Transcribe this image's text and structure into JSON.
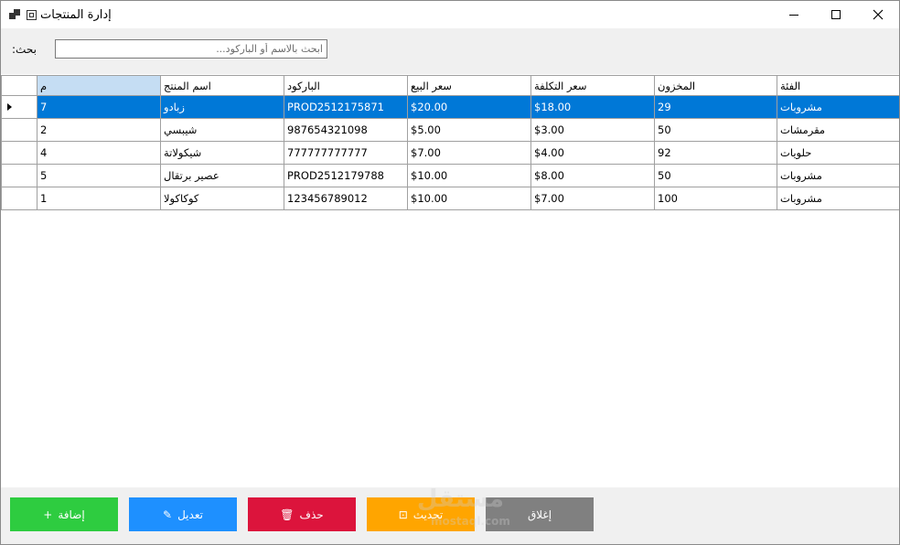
{
  "window": {
    "title": "إدارة المنتجات",
    "controls": [
      "minimize-icon",
      "maximize-icon",
      "close-icon"
    ]
  },
  "search": {
    "label": "بحث:",
    "placeholder": "ابحث بالاسم أو الباركود...",
    "value": ""
  },
  "table": {
    "columns": [
      "م",
      "اسم المنتج",
      "الباركود",
      "سعر البيع",
      "سعر التكلفة",
      "المخزون",
      "الفئة"
    ],
    "sorted_column": "م",
    "selected_row": 0,
    "rows": [
      {
        "id": "7",
        "name": "زبادو",
        "barcode": "PROD2512175871",
        "price": "$20.00",
        "cost": "$18.00",
        "stock": "29",
        "category": "مشروبات"
      },
      {
        "id": "2",
        "name": "شيبسي",
        "barcode": "987654321098",
        "price": "$5.00",
        "cost": "$3.00",
        "stock": "50",
        "category": "مقرمشات"
      },
      {
        "id": "4",
        "name": "شيكولاتة",
        "barcode": "777777777777",
        "price": "$7.00",
        "cost": "$4.00",
        "stock": "92",
        "category": "حلويات"
      },
      {
        "id": "5",
        "name": "عصير برتقال",
        "barcode": "PROD2512179788",
        "price": "$10.00",
        "cost": "$8.00",
        "stock": "50",
        "category": "مشروبات"
      },
      {
        "id": "1",
        "name": "كوكاكولا",
        "barcode": "123456789012",
        "price": "$10.00",
        "cost": "$7.00",
        "stock": "100",
        "category": "مشروبات"
      }
    ]
  },
  "buttons": {
    "add": {
      "label": "إضافة",
      "glyph": "+",
      "color": "#2ecc40"
    },
    "edit": {
      "label": "تعديل",
      "glyph": "✎",
      "color": "#1e90ff"
    },
    "delete": {
      "label": "حذف",
      "glyph": "🗑",
      "color": "#dc143c"
    },
    "refresh": {
      "label": "تحديث",
      "glyph": "⊡",
      "color": "#ffa500"
    },
    "exit": {
      "label": "إغلاق",
      "color": "#808080"
    }
  },
  "watermark": {
    "main": "مستقل",
    "sub": "mostaql.com"
  },
  "colors": {
    "selection": "#0078d7",
    "sorted_header": "#c5ddf3"
  }
}
